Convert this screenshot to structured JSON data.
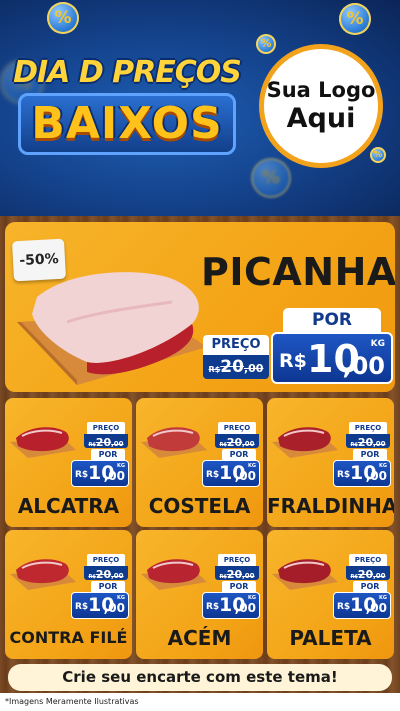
{
  "header": {
    "title_line1": "DIA D PREÇOS",
    "title_line2": "BAIXOS",
    "badge_symbol": "%",
    "logo_line1": "Sua Logo",
    "logo_line2": "Aqui"
  },
  "main_product": {
    "discount": "-50%",
    "name": "PICANHA",
    "preco_label": "PREÇO",
    "por_label": "POR",
    "old_price": {
      "currency": "R$",
      "value": "20",
      "decimals": ",00"
    },
    "new_price": {
      "currency": "R$",
      "value": "10",
      "decimals": ",00",
      "unit": "KG"
    }
  },
  "products": [
    {
      "name": "ALCATRA",
      "preco_label": "PREÇO",
      "por_label": "POR",
      "old_price": {
        "currency": "R$",
        "value": "20",
        "decimals": ",00"
      },
      "new_price": {
        "currency": "R$",
        "value": "10",
        "decimals": ",00",
        "unit": "KG"
      }
    },
    {
      "name": "COSTELA",
      "preco_label": "PREÇO",
      "por_label": "POR",
      "old_price": {
        "currency": "R$",
        "value": "20",
        "decimals": ",00"
      },
      "new_price": {
        "currency": "R$",
        "value": "10",
        "decimals": ",00",
        "unit": "KG"
      }
    },
    {
      "name": "FRALDINHA",
      "preco_label": "PREÇO",
      "por_label": "POR",
      "old_price": {
        "currency": "R$",
        "value": "20",
        "decimals": ",00"
      },
      "new_price": {
        "currency": "R$",
        "value": "10",
        "decimals": ",00",
        "unit": "KG"
      }
    },
    {
      "name": "CONTRA FILÉ",
      "preco_label": "PREÇO",
      "por_label": "POR",
      "old_price": {
        "currency": "R$",
        "value": "20",
        "decimals": ",00"
      },
      "new_price": {
        "currency": "R$",
        "value": "10",
        "decimals": ",00",
        "unit": "KG"
      }
    },
    {
      "name": "ACÉM",
      "preco_label": "PREÇO",
      "por_label": "POR",
      "old_price": {
        "currency": "R$",
        "value": "20",
        "decimals": ",00"
      },
      "new_price": {
        "currency": "R$",
        "value": "10",
        "decimals": ",00",
        "unit": "KG"
      }
    },
    {
      "name": "PALETA",
      "preco_label": "PREÇO",
      "por_label": "POR",
      "old_price": {
        "currency": "R$",
        "value": "20",
        "decimals": ",00"
      },
      "new_price": {
        "currency": "R$",
        "value": "10",
        "decimals": ",00",
        "unit": "KG"
      }
    }
  ],
  "footer": {
    "cta": "Crie seu encarte com este tema!",
    "disclaimer": "*Imagens Meramente Ilustrativas"
  },
  "colors": {
    "header_blue": "#133f86",
    "card_orange": "#f4a416",
    "price_blue": "#0f3b8f",
    "title_yellow": "#ffc21a",
    "logo_ring": "#f3a21c"
  }
}
